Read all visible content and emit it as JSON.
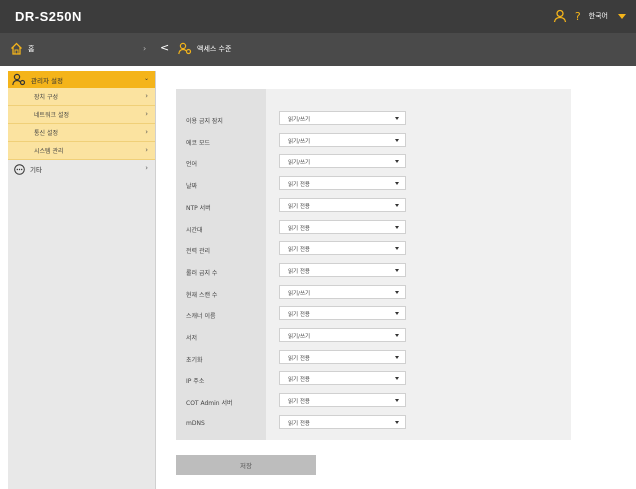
{
  "header": {
    "brand": "DR-S250N",
    "help": "?",
    "language": "한국어",
    "accent_color": "#f4b41a"
  },
  "subheader": {
    "home_label": "홈",
    "breadcrumb_label": "액세스 수준"
  },
  "sidebar": {
    "admin_label": "관리자 설정",
    "subitems": [
      {
        "label": "장치 구성"
      },
      {
        "label": "네트워크 설정"
      },
      {
        "label": "통신 설정"
      },
      {
        "label": "시스템 관리"
      }
    ],
    "other_label": "기타"
  },
  "form": {
    "rows": [
      {
        "label": "이용 금지 잠지",
        "value": "읽기/쓰기"
      },
      {
        "label": "에코 모드",
        "value": "읽기/쓰기"
      },
      {
        "label": "언어",
        "value": "읽기/쓰기"
      },
      {
        "label": "날짜",
        "value": "읽기 전용"
      },
      {
        "label": "NTP 서버",
        "value": "읽기 전용"
      },
      {
        "label": "시간대",
        "value": "읽기 전용"
      },
      {
        "label": "전력 관리",
        "value": "읽기 전용"
      },
      {
        "label": "롤러 급지 수",
        "value": "읽기 전용"
      },
      {
        "label": "현재 스캔 수",
        "value": "읽기/쓰기"
      },
      {
        "label": "스캐너 이름",
        "value": "읽기 전용"
      },
      {
        "label": "서저",
        "value": "읽기/쓰기"
      },
      {
        "label": "초기화",
        "value": "읽기 전용"
      },
      {
        "label": "IP 주소",
        "value": "읽기 전용"
      },
      {
        "label": "COT Admin 서버",
        "value": "읽기 전용"
      },
      {
        "label": "mDNS",
        "value": "읽기 전용"
      }
    ],
    "save_label": "저장"
  }
}
